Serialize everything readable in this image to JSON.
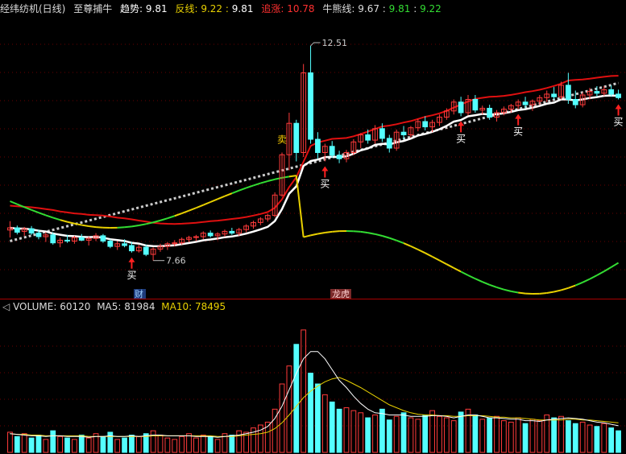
{
  "header": {
    "stock_name": "经纬纺机(日线)",
    "indicator_name": "至尊捕牛",
    "trend_label": "趋势:",
    "trend_value": "9.81",
    "reverse_label": "反线:",
    "reverse_value1": "9.22",
    "reverse_value2": "9.81",
    "chase_label": "追涨:",
    "chase_value": "10.78",
    "bullbear_label": "牛熊线:",
    "bullbear_value1": "9.67",
    "bullbear_value2": "9.81",
    "bullbear_value3": "9.22"
  },
  "volume_header": {
    "volume_label": "VOLUME:",
    "volume_value": "60120",
    "ma5_label": "MA5:",
    "ma5_value": "81984",
    "ma10_label": "MA10:",
    "ma10_value": "78495"
  },
  "annotations": {
    "high_label": "12.51",
    "low_label": "7.66",
    "buy_signals": [
      "买",
      "买",
      "买",
      "买",
      "买"
    ],
    "sell_signal": "卖",
    "tag_finance": "财",
    "tag_list": "龙虎"
  },
  "colors": {
    "up": "#ff3b3b",
    "down": "#54ffff",
    "chase_line": "#e01010",
    "trend_line": "#ffffff",
    "reverse_green": "#33dd33",
    "reverse_yellow": "#e8d000",
    "bullbear_dots": "#cccccc",
    "ma10": "#e8d000",
    "ma5": "#ffffff"
  },
  "chart_data": {
    "type": "candlestick",
    "price_range": [
      7.0,
      13.0
    ],
    "price_high": 12.51,
    "price_low": 7.66,
    "candles": [
      [
        8.35,
        8.55,
        8.18,
        8.4
      ],
      [
        8.4,
        8.45,
        8.25,
        8.3
      ],
      [
        8.32,
        8.42,
        8.22,
        8.38
      ],
      [
        8.38,
        8.44,
        8.24,
        8.28
      ],
      [
        8.28,
        8.36,
        8.14,
        8.2
      ],
      [
        8.2,
        8.3,
        8.08,
        8.24
      ],
      [
        8.24,
        8.3,
        8.02,
        8.06
      ],
      [
        8.06,
        8.18,
        7.96,
        8.12
      ],
      [
        8.12,
        8.24,
        8.06,
        8.1
      ],
      [
        8.1,
        8.22,
        8.04,
        8.18
      ],
      [
        8.18,
        8.26,
        8.1,
        8.12
      ],
      [
        8.12,
        8.2,
        8.0,
        8.16
      ],
      [
        8.16,
        8.28,
        8.1,
        8.22
      ],
      [
        8.22,
        8.26,
        8.06,
        8.1
      ],
      [
        8.1,
        8.14,
        7.94,
        7.98
      ],
      [
        7.98,
        8.1,
        7.9,
        8.04
      ],
      [
        8.04,
        8.14,
        7.96,
        8.0
      ],
      [
        8.0,
        8.08,
        7.84,
        7.88
      ],
      [
        7.88,
        8.02,
        7.84,
        7.96
      ],
      [
        7.96,
        8.02,
        7.76,
        7.8
      ],
      [
        7.8,
        7.96,
        7.66,
        7.92
      ],
      [
        7.92,
        8.04,
        7.86,
        7.98
      ],
      [
        7.98,
        8.08,
        7.9,
        8.04
      ],
      [
        8.04,
        8.12,
        7.98,
        8.06
      ],
      [
        8.06,
        8.18,
        8.02,
        8.14
      ],
      [
        8.14,
        8.22,
        8.08,
        8.18
      ],
      [
        8.18,
        8.24,
        8.1,
        8.2
      ],
      [
        8.2,
        8.32,
        8.14,
        8.28
      ],
      [
        8.28,
        8.34,
        8.18,
        8.22
      ],
      [
        8.22,
        8.3,
        8.12,
        8.26
      ],
      [
        8.26,
        8.36,
        8.2,
        8.32
      ],
      [
        8.32,
        8.4,
        8.24,
        8.28
      ],
      [
        8.28,
        8.4,
        8.22,
        8.36
      ],
      [
        8.36,
        8.48,
        8.3,
        8.44
      ],
      [
        8.44,
        8.56,
        8.38,
        8.52
      ],
      [
        8.52,
        8.64,
        8.46,
        8.6
      ],
      [
        8.6,
        8.72,
        8.54,
        8.68
      ],
      [
        8.68,
        9.2,
        8.64,
        9.14
      ],
      [
        9.14,
        10.1,
        9.1,
        10.05
      ],
      [
        10.05,
        11.0,
        9.7,
        10.76
      ],
      [
        10.76,
        10.84,
        9.9,
        10.1
      ],
      [
        10.1,
        12.1,
        10.0,
        11.9
      ],
      [
        11.9,
        12.51,
        10.3,
        10.4
      ],
      [
        10.4,
        10.56,
        9.96,
        10.1
      ],
      [
        10.1,
        10.3,
        9.9,
        10.24
      ],
      [
        10.24,
        10.36,
        9.98,
        10.04
      ],
      [
        10.04,
        10.14,
        9.86,
        9.96
      ],
      [
        9.96,
        10.16,
        9.88,
        10.1
      ],
      [
        10.1,
        10.4,
        10.04,
        10.34
      ],
      [
        10.34,
        10.54,
        10.2,
        10.5
      ],
      [
        10.5,
        10.62,
        10.3,
        10.38
      ],
      [
        10.38,
        10.72,
        10.3,
        10.64
      ],
      [
        10.64,
        10.76,
        10.34,
        10.42
      ],
      [
        10.42,
        10.5,
        10.1,
        10.2
      ],
      [
        10.2,
        10.62,
        10.14,
        10.56
      ],
      [
        10.56,
        10.7,
        10.4,
        10.5
      ],
      [
        10.5,
        10.7,
        10.44,
        10.66
      ],
      [
        10.66,
        10.86,
        10.58,
        10.8
      ],
      [
        10.8,
        10.92,
        10.6,
        10.68
      ],
      [
        10.68,
        10.84,
        10.56,
        10.78
      ],
      [
        10.78,
        10.96,
        10.7,
        10.9
      ],
      [
        10.9,
        11.1,
        10.84,
        11.04
      ],
      [
        11.04,
        11.3,
        10.96,
        11.24
      ],
      [
        11.24,
        11.36,
        10.92,
        11.0
      ],
      [
        11.0,
        11.4,
        10.94,
        11.3
      ],
      [
        11.3,
        11.4,
        11.0,
        11.06
      ],
      [
        11.06,
        11.16,
        10.96,
        11.1
      ],
      [
        11.1,
        11.18,
        10.84,
        10.9
      ],
      [
        10.9,
        11.06,
        10.8,
        11.0
      ],
      [
        11.0,
        11.14,
        10.94,
        11.08
      ],
      [
        11.08,
        11.2,
        11.0,
        11.16
      ],
      [
        11.16,
        11.3,
        11.08,
        11.24
      ],
      [
        11.24,
        11.36,
        11.1,
        11.18
      ],
      [
        11.18,
        11.3,
        11.04,
        11.26
      ],
      [
        11.26,
        11.4,
        11.18,
        11.34
      ],
      [
        11.34,
        11.5,
        11.24,
        11.42
      ],
      [
        11.42,
        11.58,
        11.3,
        11.36
      ],
      [
        11.36,
        11.7,
        11.3,
        11.62
      ],
      [
        11.62,
        11.9,
        11.2,
        11.3
      ],
      [
        11.3,
        11.5,
        11.1,
        11.18
      ],
      [
        11.18,
        11.46,
        11.12,
        11.4
      ],
      [
        11.4,
        11.56,
        11.3,
        11.48
      ],
      [
        11.48,
        11.6,
        11.36,
        11.44
      ],
      [
        11.44,
        11.6,
        11.38,
        11.52
      ],
      [
        11.52,
        11.62,
        11.36,
        11.42
      ],
      [
        11.42,
        11.52,
        11.3,
        11.34
      ]
    ],
    "volume": [
      28,
      22,
      26,
      20,
      24,
      18,
      30,
      22,
      20,
      18,
      24,
      20,
      26,
      22,
      28,
      18,
      20,
      24,
      22,
      26,
      30,
      24,
      20,
      18,
      22,
      26,
      20,
      24,
      22,
      18,
      26,
      24,
      30,
      28,
      34,
      38,
      42,
      60,
      95,
      120,
      150,
      170,
      110,
      95,
      80,
      70,
      60,
      62,
      58,
      55,
      48,
      52,
      60,
      45,
      50,
      55,
      48,
      46,
      52,
      58,
      50,
      48,
      44,
      56,
      60,
      52,
      46,
      48,
      50,
      44,
      42,
      48,
      40,
      46,
      44,
      52,
      48,
      50,
      44,
      40,
      42,
      38,
      36,
      40,
      34,
      30
    ],
    "ma5": [
      26,
      25,
      24,
      23,
      23,
      22,
      23,
      23,
      22,
      22,
      22,
      21,
      22,
      22,
      23,
      22,
      22,
      23,
      22,
      23,
      24,
      24,
      23,
      23,
      23,
      23,
      22,
      22,
      22,
      21,
      22,
      23,
      24,
      26,
      28,
      31,
      36,
      47,
      64,
      87,
      110,
      130,
      140,
      140,
      130,
      115,
      100,
      90,
      78,
      68,
      60,
      55,
      54,
      52,
      52,
      52,
      50,
      50,
      50,
      51,
      51,
      50,
      48,
      50,
      52,
      52,
      50,
      48,
      48,
      47,
      46,
      46,
      44,
      44,
      43,
      45,
      46,
      47,
      48,
      47,
      46,
      44,
      42,
      41,
      39,
      37
    ],
    "ma10": [
      26,
      25,
      25,
      24,
      24,
      23,
      23,
      23,
      23,
      23,
      23,
      22,
      22,
      22,
      22,
      22,
      22,
      22,
      22,
      22,
      23,
      23,
      23,
      23,
      23,
      23,
      23,
      23,
      23,
      22,
      22,
      22,
      23,
      24,
      25,
      26,
      28,
      33,
      41,
      52,
      64,
      76,
      85,
      92,
      98,
      102,
      104,
      100,
      95,
      90,
      84,
      78,
      72,
      66,
      62,
      58,
      55,
      53,
      52,
      52,
      51,
      51,
      50,
      50,
      51,
      51,
      51,
      50,
      49,
      49,
      48,
      48,
      47,
      46,
      45,
      45,
      45,
      45,
      46,
      46,
      45,
      45,
      44,
      43,
      42,
      41
    ],
    "volume_range": [
      0,
      190
    ]
  }
}
